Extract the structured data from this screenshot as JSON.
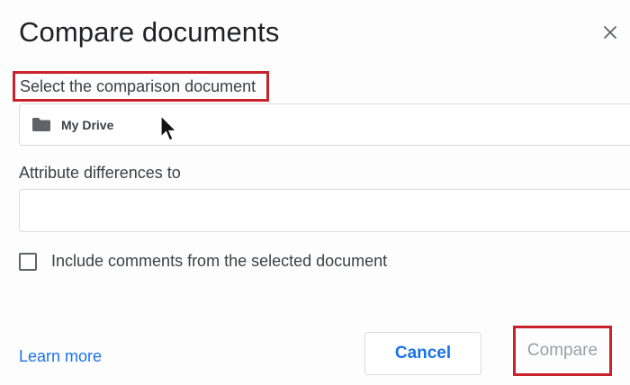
{
  "dialog": {
    "title": "Compare documents",
    "close_icon": "close-icon"
  },
  "comparison_document": {
    "label": "Select the comparison document",
    "folder_icon": "folder-icon",
    "value": "My Drive"
  },
  "attribute": {
    "label": "Attribute differences to",
    "value": ""
  },
  "include_comments": {
    "label": "Include comments from the selected document",
    "checked": false
  },
  "footer": {
    "learn_more": "Learn more",
    "cancel": "Cancel",
    "compare": "Compare"
  },
  "colors": {
    "accent": "#1a73e8",
    "highlight_box": "#c8232c",
    "disabled_text": "#9aa0a6"
  }
}
